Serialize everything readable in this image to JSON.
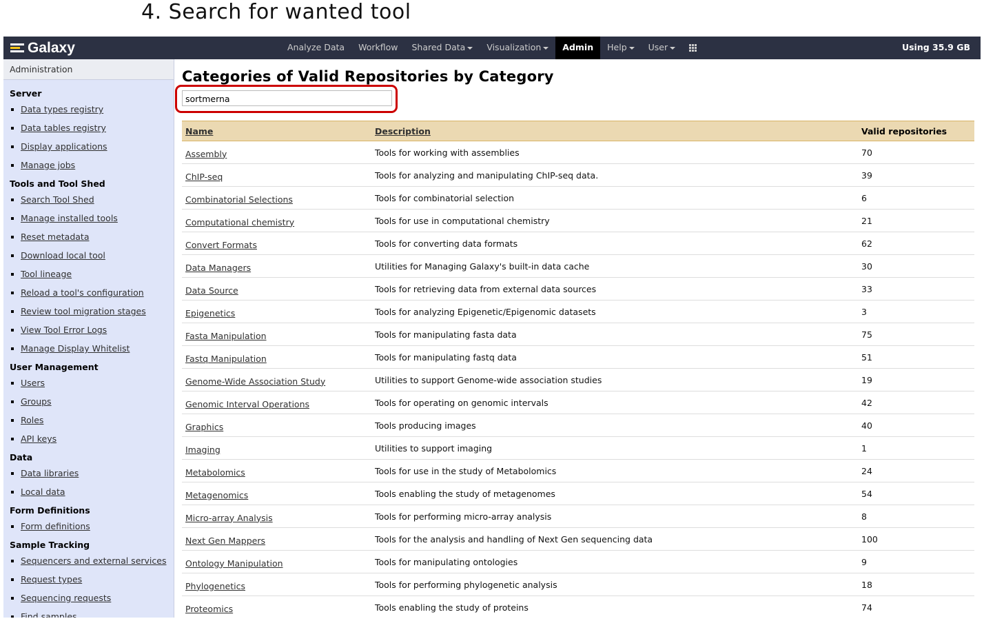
{
  "step_title": "4. Search for wanted tool",
  "masthead": {
    "brand": "Galaxy",
    "nav": [
      {
        "label": "Analyze Data",
        "dropdown": false,
        "active": false
      },
      {
        "label": "Workflow",
        "dropdown": false,
        "active": false
      },
      {
        "label": "Shared Data",
        "dropdown": true,
        "active": false
      },
      {
        "label": "Visualization",
        "dropdown": true,
        "active": false
      },
      {
        "label": "Admin",
        "dropdown": false,
        "active": true
      },
      {
        "label": "Help",
        "dropdown": true,
        "active": false
      },
      {
        "label": "User",
        "dropdown": true,
        "active": false
      }
    ],
    "apps_icon": "grid-icon",
    "usage": "Using 35.9 GB"
  },
  "sidebar": {
    "header": "Administration",
    "sections": [
      {
        "title": "Server",
        "items": [
          "Data types registry",
          "Data tables registry",
          "Display applications",
          "Manage jobs"
        ]
      },
      {
        "title": "Tools and Tool Shed",
        "items": [
          "Search Tool Shed",
          "Manage installed tools",
          "Reset metadata",
          "Download local tool",
          "Tool lineage",
          "Reload a tool's configuration",
          "Review tool migration stages",
          "View Tool Error Logs",
          "Manage Display Whitelist"
        ]
      },
      {
        "title": "User Management",
        "items": [
          "Users",
          "Groups",
          "Roles",
          "API keys"
        ]
      },
      {
        "title": "Data",
        "items": [
          "Data libraries",
          "Local data"
        ]
      },
      {
        "title": "Form Definitions",
        "items": [
          "Form definitions"
        ]
      },
      {
        "title": "Sample Tracking",
        "items": [
          "Sequencers and external services",
          "Request types",
          "Sequencing requests",
          "Find samples"
        ]
      }
    ]
  },
  "main": {
    "title": "Categories of Valid Repositories by Category",
    "search": {
      "value": "sortmerna"
    },
    "table": {
      "headers": {
        "name": "Name",
        "description": "Description",
        "count": "Valid repositories"
      },
      "rows": [
        {
          "name": "Assembly",
          "description": "Tools for working with assemblies",
          "count": "70"
        },
        {
          "name": "ChIP-seq",
          "description": "Tools for analyzing and manipulating ChIP-seq data.",
          "count": "39"
        },
        {
          "name": "Combinatorial Selections",
          "description": "Tools for combinatorial selection",
          "count": "6"
        },
        {
          "name": "Computational chemistry",
          "description": "Tools for use in computational chemistry",
          "count": "21"
        },
        {
          "name": "Convert Formats",
          "description": "Tools for converting data formats",
          "count": "62"
        },
        {
          "name": "Data Managers",
          "description": "Utilities for Managing Galaxy's built-in data cache",
          "count": "30"
        },
        {
          "name": "Data Source",
          "description": "Tools for retrieving data from external data sources",
          "count": "33"
        },
        {
          "name": "Epigenetics",
          "description": "Tools for analyzing Epigenetic/Epigenomic datasets",
          "count": "3"
        },
        {
          "name": "Fasta Manipulation",
          "description": "Tools for manipulating fasta data",
          "count": "75"
        },
        {
          "name": "Fastq Manipulation",
          "description": "Tools for manipulating fastq data",
          "count": "51"
        },
        {
          "name": "Genome-Wide Association Study",
          "description": "Utilities to support Genome-wide association studies",
          "count": "19"
        },
        {
          "name": "Genomic Interval Operations",
          "description": "Tools for operating on genomic intervals",
          "count": "42"
        },
        {
          "name": "Graphics",
          "description": "Tools producing images",
          "count": "40"
        },
        {
          "name": "Imaging",
          "description": "Utilities to support imaging",
          "count": "1"
        },
        {
          "name": "Metabolomics",
          "description": "Tools for use in the study of Metabolomics",
          "count": "24"
        },
        {
          "name": "Metagenomics",
          "description": "Tools enabling the study of metagenomes",
          "count": "54"
        },
        {
          "name": "Micro-array Analysis",
          "description": "Tools for performing micro-array analysis",
          "count": "8"
        },
        {
          "name": "Next Gen Mappers",
          "description": "Tools for the analysis and handling of Next Gen sequencing data",
          "count": "100"
        },
        {
          "name": "Ontology Manipulation",
          "description": "Tools for manipulating ontologies",
          "count": "9"
        },
        {
          "name": "Phylogenetics",
          "description": "Tools for performing phylogenetic analysis",
          "count": "18"
        },
        {
          "name": "Proteomics",
          "description": "Tools enabling the study of proteins",
          "count": "74"
        }
      ]
    }
  }
}
